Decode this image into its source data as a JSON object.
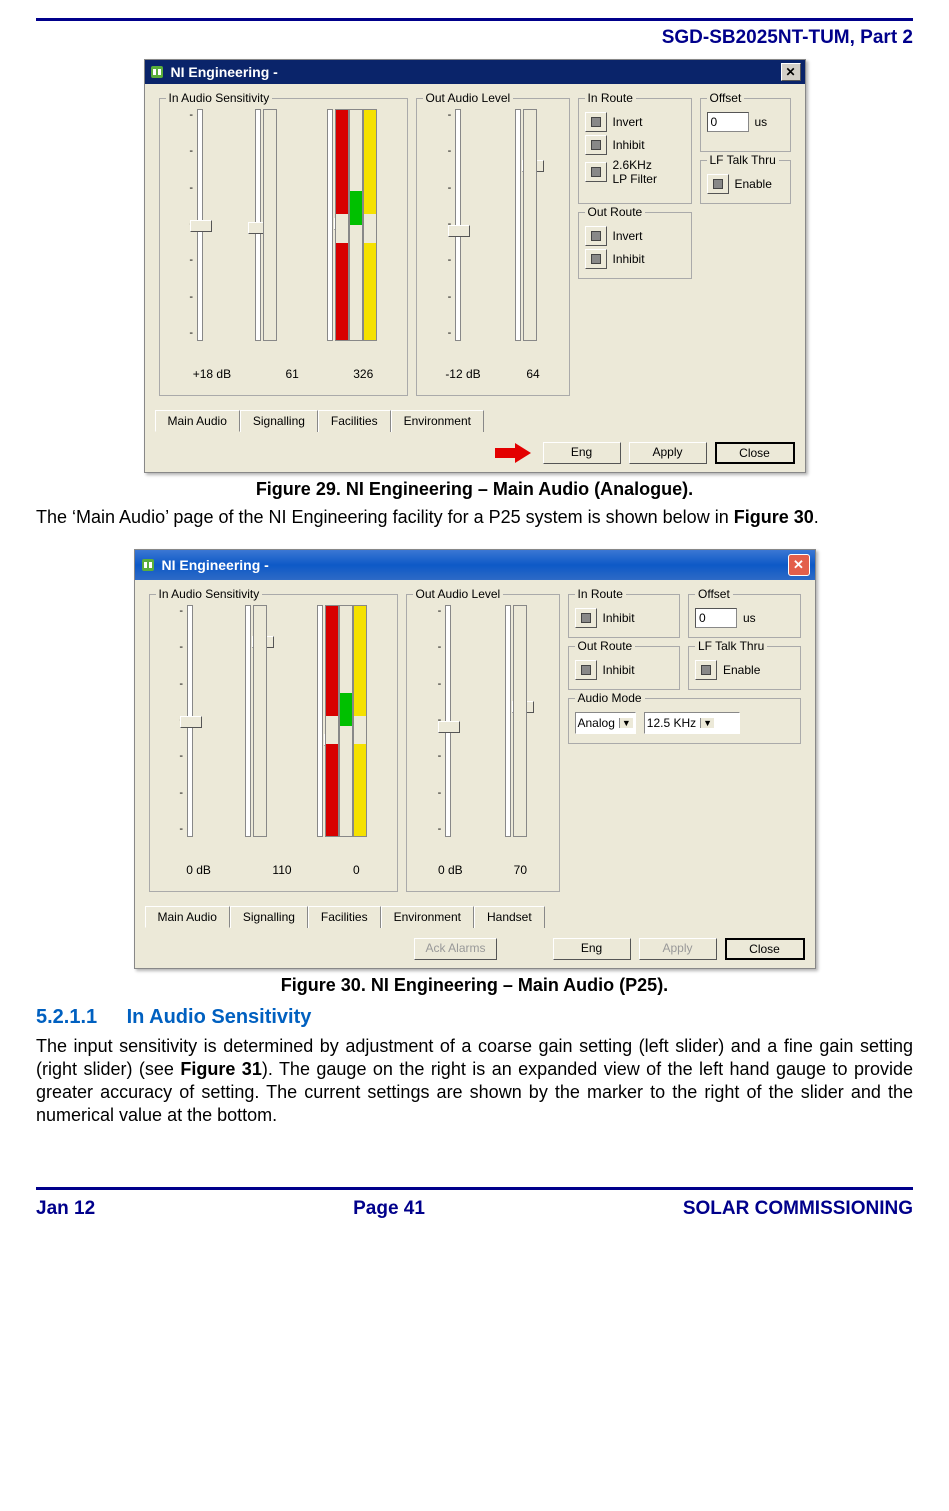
{
  "header": {
    "title": "SGD-SB2025NT-TUM, Part 2"
  },
  "footer": {
    "left": "Jan 12",
    "center": "Page 41",
    "right": "SOLAR COMMISSIONING"
  },
  "fig29": {
    "caption": "Figure 29.  NI Engineering – Main Audio (Analogue).",
    "title": "NI Engineering -",
    "groups": {
      "in_audio": "In Audio Sensitivity",
      "out_audio": "Out Audio Level",
      "in_route": "In Route",
      "out_route": "Out Route",
      "offset": "Offset",
      "lf_talk": "LF Talk Thru"
    },
    "in_audio": {
      "db": "+18 dB",
      "coarse": "61",
      "fine": "326"
    },
    "out_audio": {
      "db": "-12 dB",
      "val": "64"
    },
    "in_route": {
      "invert": "Invert",
      "inhibit": "Inhibit",
      "lp": "2.6KHz\nLP Filter"
    },
    "out_route": {
      "invert": "Invert",
      "inhibit": "Inhibit"
    },
    "offset": {
      "value": "0",
      "unit": "us"
    },
    "lf_talk": {
      "enable": "Enable"
    },
    "tabs": [
      "Main Audio",
      "Signalling",
      "Facilities",
      "Environment"
    ],
    "buttons": {
      "eng": "Eng",
      "apply": "Apply",
      "close": "Close"
    }
  },
  "para1": "The ‘Main Audio’ page of the NI Engineering facility for a P25 system is shown below in ",
  "para1b": "Figure 30",
  "para1c": ".",
  "fig30": {
    "caption": "Figure 30.  NI Engineering – Main Audio (P25).",
    "title": "NI Engineering -",
    "groups": {
      "in_audio": "In Audio Sensitivity",
      "out_audio": "Out Audio Level",
      "in_route": "In Route",
      "out_route": "Out Route",
      "offset": "Offset",
      "lf_talk": "LF Talk Thru",
      "audio_mode": "Audio Mode"
    },
    "in_audio": {
      "db": "0 dB",
      "coarse": "110",
      "fine": "0"
    },
    "out_audio": {
      "db": "0 dB",
      "val": "70"
    },
    "in_route": {
      "inhibit": "Inhibit"
    },
    "out_route": {
      "inhibit": "Inhibit"
    },
    "offset": {
      "value": "0",
      "unit": "us"
    },
    "lf_talk": {
      "enable": "Enable"
    },
    "audio_mode": {
      "mode": "Analog",
      "bw": "12.5 KHz"
    },
    "tabs": [
      "Main Audio",
      "Signalling",
      "Facilities",
      "Environment",
      "Handset"
    ],
    "buttons": {
      "ack": "Ack Alarms",
      "eng": "Eng",
      "apply": "Apply",
      "close": "Close"
    }
  },
  "section": {
    "num": "5.2.1.1",
    "title": "In Audio Sensitivity"
  },
  "para2a": "The input sensitivity is determined by adjustment of a coarse gain setting (left slider) and a fine gain setting (right slider) (see ",
  "para2b": "Figure 31",
  "para2c": ").  The gauge on the right is an expanded view of the left hand gauge to provide greater accuracy of setting.  The current settings are shown by the marker to the right of the slider and the numerical value at the bottom."
}
